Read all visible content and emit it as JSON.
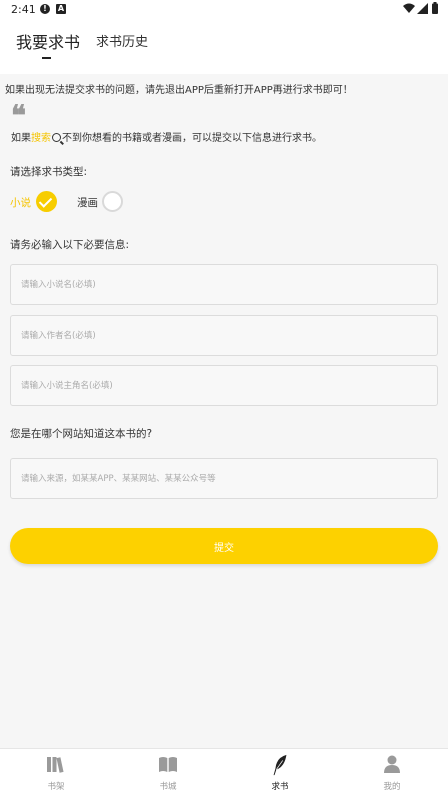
{
  "status_bar": {
    "time": "2:41"
  },
  "header": {
    "tabs": [
      {
        "label": "我要求书",
        "active": true
      },
      {
        "label": "求书历史",
        "active": false
      }
    ]
  },
  "notice": "如果出现无法提交求书的问题，请先退出APP后重新打开APP再进行求书即可！",
  "quote_mark": "❝",
  "intro": {
    "before": "如果",
    "highlight": "搜索",
    "after": "不到你想看的书籍或者漫画，可以提交以下信息进行求书。"
  },
  "type_section": {
    "label": "请选择求书类型:",
    "options": [
      {
        "label": "小说",
        "selected": true
      },
      {
        "label": "漫画",
        "selected": false
      }
    ]
  },
  "required_label": "请务必输入以下必要信息:",
  "fields": {
    "novel_name_placeholder": "请输入小说名(必填)",
    "author_placeholder": "请输入作者名(必填)",
    "protagonist_placeholder": "请输入小说主角名(必填)"
  },
  "source_label": "您是在哪个网站知道这本书的?",
  "source_placeholder": "请输入来源，如某某APP、某某网站、某某公众号等",
  "submit_label": "提交",
  "bottom_nav": [
    {
      "label": "书架",
      "icon": "bookshelf-icon",
      "active": false
    },
    {
      "label": "书城",
      "icon": "open-book-icon",
      "active": false
    },
    {
      "label": "求书",
      "icon": "feather-icon",
      "active": true
    },
    {
      "label": "我的",
      "icon": "user-icon",
      "active": false
    }
  ],
  "colors": {
    "accent": "#fdd100",
    "highlight_text": "#f5c400"
  }
}
